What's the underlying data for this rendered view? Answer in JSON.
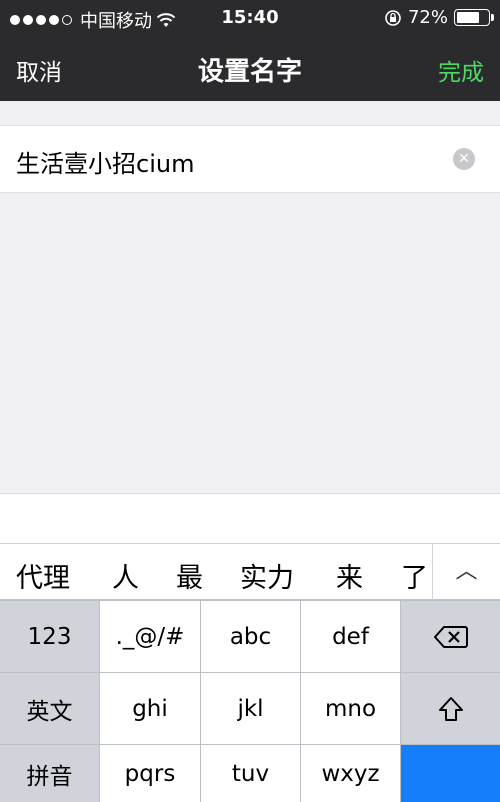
{
  "status_bar": {
    "carrier": "中国移动",
    "wifi_icon": "wifi-icon",
    "time": "15:40",
    "orientation_lock_icon": "rotation-lock-icon",
    "battery_percent": "72%",
    "battery_level": 0.72
  },
  "nav": {
    "cancel_label": "取消",
    "title": "设置名字",
    "done_label": "完成",
    "done_color": "#4cd964"
  },
  "input": {
    "value": "生活壹小招cium",
    "clear_icon": "clear-icon"
  },
  "candidates": {
    "items": [
      "代理",
      "人",
      "最",
      "实力",
      "来",
      "了"
    ],
    "expand_icon": "chevron-up-icon",
    "expand_glyph": "︿"
  },
  "keyboard": {
    "row1": [
      "123",
      "._@/#",
      "abc",
      "def"
    ],
    "row2": [
      "英文",
      "ghi",
      "jkl",
      "mno"
    ],
    "row3": [
      "拼音",
      "pqrs",
      "tuv",
      "wxyz"
    ],
    "backspace_icon": "backspace-icon",
    "shift_icon": "shift-icon",
    "accent_color": "#157efb"
  }
}
